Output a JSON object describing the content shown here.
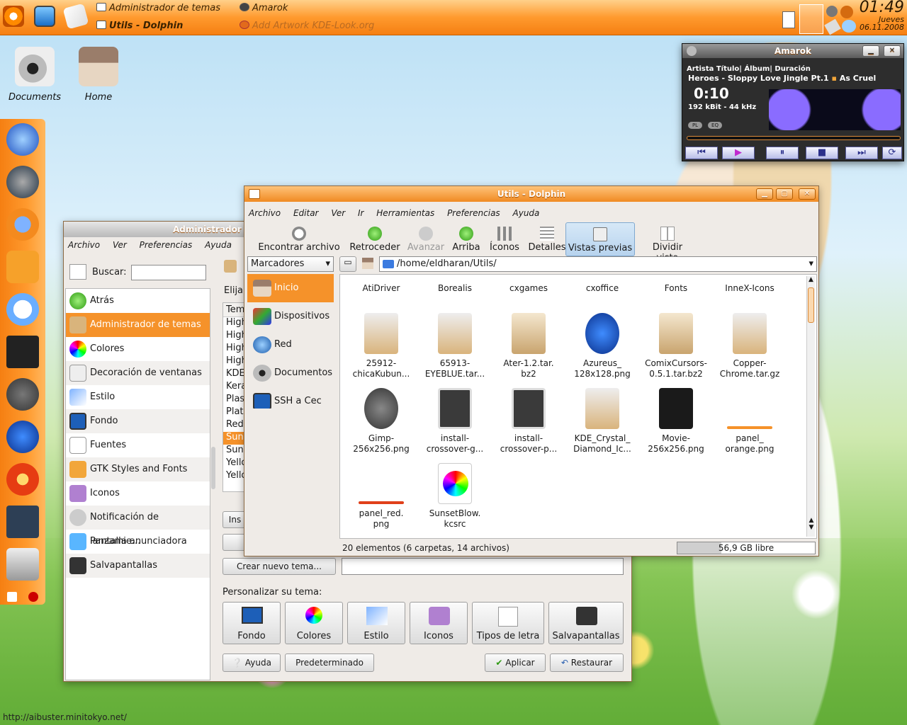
{
  "taskbar": {
    "task1": "Administrador de temas",
    "task2": "Utils - Dolphin",
    "task3": "Amarok",
    "task4": "Add Artwork KDE-Look.org",
    "clock_time": "01:49",
    "clock_day": "Jueves",
    "clock_date": "06.11.2008"
  },
  "desktop": {
    "icons": [
      "Documents",
      "Home"
    ],
    "watermark": "http://aibuster.minitokyo.net/"
  },
  "amarok": {
    "title": "Amarok",
    "columns": "Artista Título| Álbum| Duración",
    "track": "Heroes - Sloppy Love Jingle Pt.1",
    "track2": "As Cruel",
    "time": "0:10",
    "bitrate": "192 kBit - 44 kHz",
    "pl": "PL",
    "eq": "EQ"
  },
  "theme_manager": {
    "title": "Administrador de temas",
    "menu": [
      "Archivo",
      "Ver",
      "Preferencias",
      "Ayuda"
    ],
    "search_label": "Buscar:",
    "search_value": "",
    "nav": [
      "Atrás",
      "Administrador de temas",
      "Colores",
      "Decoración de ventanas",
      "Estilo",
      "Fondo",
      "Fuentes",
      "GTK Styles and Fonts",
      "Iconos",
      "Notificación de lanzamie...",
      "Pantalla anunciadora",
      "Salvapantallas"
    ],
    "elija": "Elija",
    "theme_header": "Tem",
    "themes": [
      "High",
      "High",
      "High",
      "High",
      "KDE_",
      "Kera",
      "Plas",
      "Plati",
      "Redr",
      "Suns",
      "Suns",
      "Yello",
      "Yello"
    ],
    "install_btn": "Ins",
    "create_btn": "Crear nuevo tema...",
    "personalize_label": "Personalizar su tema:",
    "personalize": [
      "Fondo",
      "Colores",
      "Estilo",
      "Iconos",
      "Tipos de letra",
      "Salvapantallas"
    ],
    "help_btn": "Ayuda",
    "default_btn": "Predeterminado",
    "apply_btn": "Aplicar",
    "reset_btn": "Restaurar"
  },
  "dolphin": {
    "title": "Utils - Dolphin",
    "menu": [
      "Archivo",
      "Editar",
      "Ver",
      "Ir",
      "Herramientas",
      "Preferencias",
      "Ayuda"
    ],
    "toolbar": [
      "Encontrar archivo",
      "Retroceder",
      "Avanzar",
      "Arriba",
      "Íconos",
      "Detalles",
      "Vistas previas",
      "Dividir vista"
    ],
    "places_combo": "Marcadores",
    "places": [
      "Inicio",
      "Dispositivos",
      "Red",
      "Documentos",
      "SSH a Cec"
    ],
    "path": "/home/eldharan/Utils/",
    "folders": [
      "AtiDriver",
      "Borealis",
      "cxgames",
      "cxoffice",
      "Fonts",
      "InneX-Icons"
    ],
    "files": [
      [
        "25912-",
        "chicaKubun..."
      ],
      [
        "65913-",
        "EYEBLUE.tar..."
      ],
      [
        "Ater-1.2.tar.",
        "bz2"
      ],
      [
        "Azureus_",
        "128x128.png"
      ],
      [
        "ComixCursors-",
        "0.5.1.tar.bz2"
      ],
      [
        "Copper-",
        "Chrome.tar.gz"
      ],
      [
        "Gimp-",
        "256x256.png"
      ],
      [
        "install-",
        "crossover-g..."
      ],
      [
        "install-",
        "crossover-p..."
      ],
      [
        "KDE_Crystal_",
        "Diamond_Ic..."
      ],
      [
        "Movie-",
        "256x256.png"
      ],
      [
        "panel_",
        "orange.png"
      ],
      [
        "panel_red.",
        "png"
      ],
      [
        "SunsetBlow.",
        "kcsrc"
      ]
    ],
    "status": "20 elementos (6 carpetas, 14 archivos)",
    "free": "56,9 GB libre",
    "free_fraction": 0.32
  }
}
